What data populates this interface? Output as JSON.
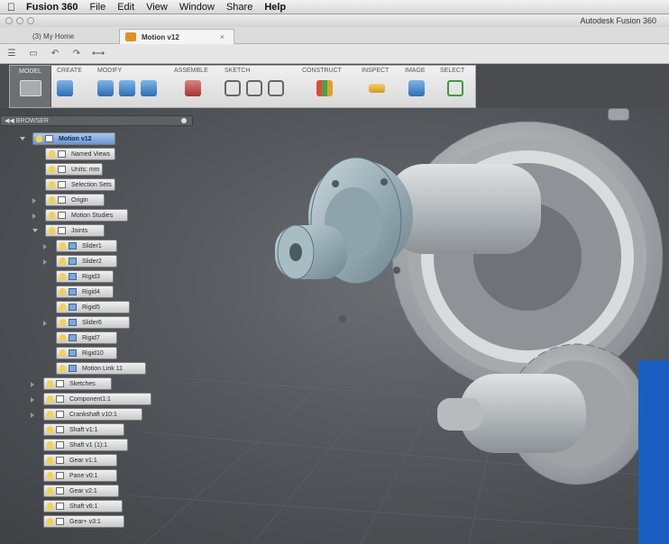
{
  "menubar": {
    "app": "Fusion 360",
    "items": [
      "File",
      "Edit",
      "View",
      "Window",
      "Share",
      "Help"
    ]
  },
  "window": {
    "title": "Autodesk Fusion 360"
  },
  "tabs": [
    {
      "label": "(3) My Home"
    },
    {
      "label": "Motion v12",
      "close": "×"
    }
  ],
  "ribbon": {
    "model_label": "MODEL",
    "groups": [
      "CREATE",
      "MODIFY",
      "ASSEMBLE",
      "SKETCH",
      "CONSTRUCT",
      "INSPECT",
      "IMAGE",
      "SELECT"
    ]
  },
  "browser": {
    "header": "BROWSER",
    "nodes": [
      {
        "label": "Motion v12"
      },
      {
        "label": "Named Views"
      },
      {
        "label": "Units: mm"
      },
      {
        "label": "Selection Sets"
      },
      {
        "label": "Origin"
      },
      {
        "label": "Motion Studies"
      },
      {
        "label": "Joints"
      },
      {
        "label": "Slider1"
      },
      {
        "label": "Slider2"
      },
      {
        "label": "Rigid3"
      },
      {
        "label": "Rigid4"
      },
      {
        "label": "Rigid5"
      },
      {
        "label": "Slider6"
      },
      {
        "label": "Rigid7"
      },
      {
        "label": "Rigid10"
      },
      {
        "label": "Motion Link 11"
      },
      {
        "label": "Sketches"
      },
      {
        "label": "Component1:1"
      },
      {
        "label": "Crankshaft v10:1"
      },
      {
        "label": "Shaft v1:1"
      },
      {
        "label": "Shaft v1 (1):1"
      },
      {
        "label": "Gear v1:1"
      },
      {
        "label": "Pane v0:1"
      },
      {
        "label": "Gear v2:1"
      },
      {
        "label": "Shaft v6:1"
      },
      {
        "label": "Gear+ v3:1"
      }
    ]
  },
  "colors": {
    "accent": "#6e95cc",
    "viewport": "#54575b",
    "gear": "#b9bcbf",
    "hub": "#9fb4bd"
  }
}
